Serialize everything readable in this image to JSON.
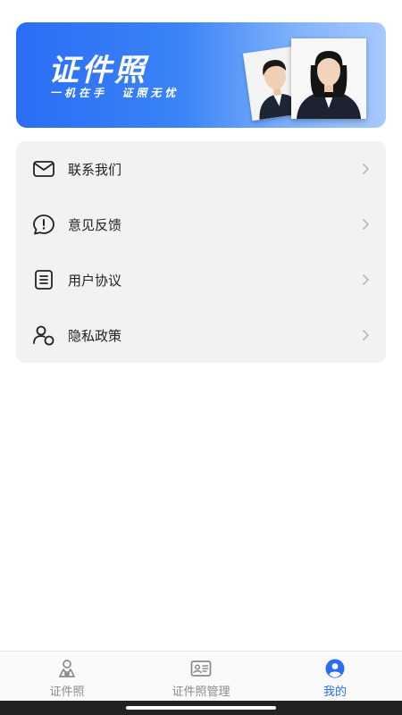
{
  "banner": {
    "title": "证件照",
    "subtitle": "一机在手  证照无忧"
  },
  "menu": {
    "items": [
      {
        "label": "联系我们",
        "icon": "mail-icon"
      },
      {
        "label": "意见反馈",
        "icon": "feedback-icon"
      },
      {
        "label": "用户协议",
        "icon": "document-icon"
      },
      {
        "label": "隐私政策",
        "icon": "privacy-icon"
      }
    ]
  },
  "tabbar": {
    "tabs": [
      {
        "label": "证件照",
        "icon": "camera-person-icon",
        "active": false
      },
      {
        "label": "证件照管理",
        "icon": "id-card-icon",
        "active": false
      },
      {
        "label": "我的",
        "icon": "profile-icon",
        "active": true
      }
    ]
  },
  "colors": {
    "accent": "#2a6df5",
    "menu_bg": "#f2f2f2",
    "inactive": "#8a8a8a"
  }
}
